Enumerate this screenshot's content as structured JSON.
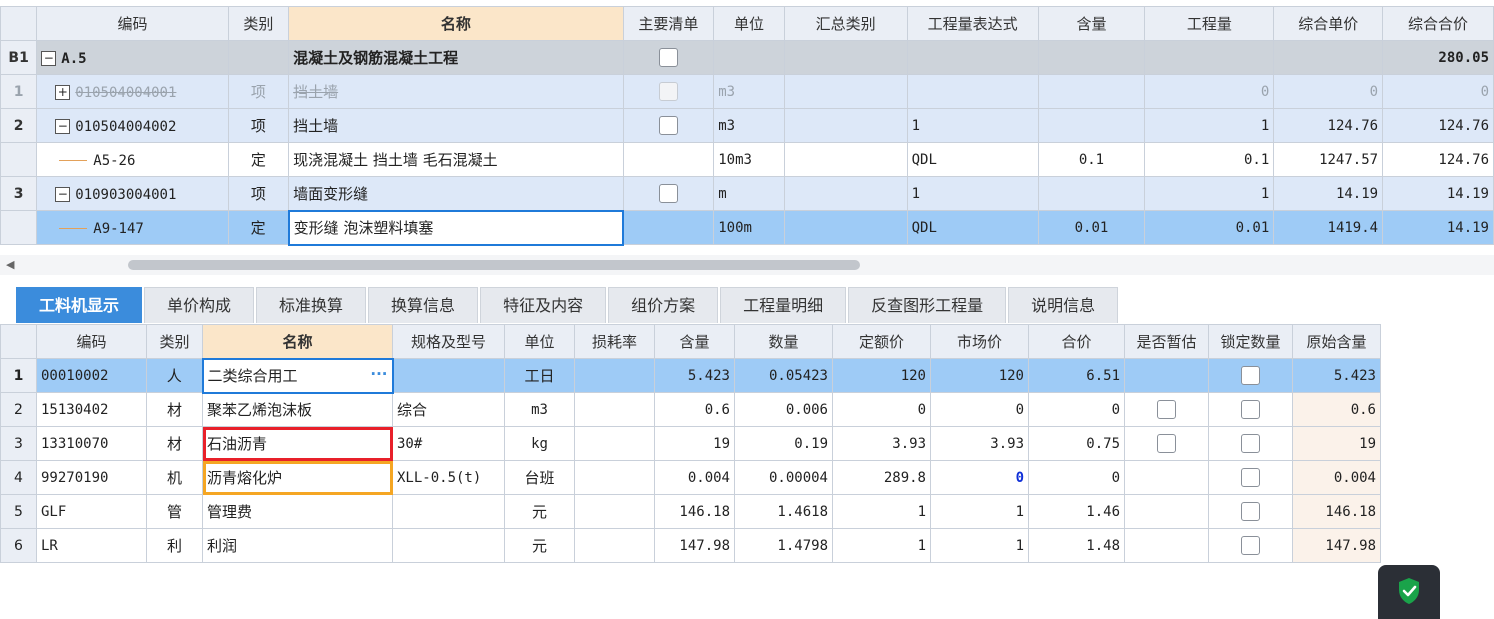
{
  "top_table": {
    "headers": [
      "",
      "编码",
      "类别",
      "名称",
      "主要清单",
      "单位",
      "汇总类别",
      "工程量表达式",
      "含量",
      "工程量",
      "综合单价",
      "综合合价"
    ],
    "rows": [
      {
        "rn": "B1",
        "code": "A.5",
        "type": "",
        "name": "混凝土及钢筋混凝土工程",
        "unit": "",
        "summary": "",
        "expr": "",
        "content": "",
        "qty": "",
        "unit_price": "",
        "total": "280.05"
      },
      {
        "rn": "1",
        "code": "010504004001",
        "type": "项",
        "name": "挡土墙",
        "unit": "m3",
        "summary": "",
        "expr": "",
        "content": "",
        "qty": "0",
        "unit_price": "0",
        "total": "0"
      },
      {
        "rn": "2",
        "code": "010504004002",
        "type": "项",
        "name": "挡土墙",
        "unit": "m3",
        "summary": "",
        "expr": "1",
        "content": "",
        "qty": "1",
        "unit_price": "124.76",
        "total": "124.76"
      },
      {
        "rn": "",
        "code": "A5-26",
        "type": "定",
        "name": "现浇混凝土 挡土墙 毛石混凝土",
        "unit": "10m3",
        "summary": "",
        "expr": "QDL",
        "content": "0.1",
        "qty": "0.1",
        "unit_price": "1247.57",
        "total": "124.76"
      },
      {
        "rn": "3",
        "code": "010903004001",
        "type": "项",
        "name": "墙面变形缝",
        "unit": "m",
        "summary": "",
        "expr": "1",
        "content": "",
        "qty": "1",
        "unit_price": "14.19",
        "total": "14.19"
      },
      {
        "rn": "",
        "code": "A9-147",
        "type": "定",
        "name": "变形缝 泡沫塑料填塞",
        "unit": "100m",
        "summary": "",
        "expr": "QDL",
        "content": "0.01",
        "qty": "0.01",
        "unit_price": "1419.4",
        "total": "14.19"
      }
    ]
  },
  "tabs": [
    "工料机显示",
    "单价构成",
    "标准换算",
    "换算信息",
    "特征及内容",
    "组价方案",
    "工程量明细",
    "反查图形工程量",
    "说明信息"
  ],
  "bottom_table": {
    "headers": [
      "",
      "编码",
      "类别",
      "名称",
      "规格及型号",
      "单位",
      "损耗率",
      "含量",
      "数量",
      "定额价",
      "市场价",
      "合价",
      "是否暂估",
      "锁定数量",
      "原始含量"
    ],
    "rows": [
      {
        "rn": "1",
        "code": "00010002",
        "type": "人",
        "name": "二类综合用工",
        "spec": "",
        "unit": "工日",
        "loss": "",
        "content": "5.423",
        "qty": "0.05423",
        "quota": "120",
        "market": "120",
        "sum": "6.51",
        "orig": "5.423"
      },
      {
        "rn": "2",
        "code": "15130402",
        "type": "材",
        "name": "聚苯乙烯泡沫板",
        "spec": "综合",
        "unit": "m3",
        "loss": "",
        "content": "0.6",
        "qty": "0.006",
        "quota": "0",
        "market": "0",
        "sum": "0",
        "orig": "0.6"
      },
      {
        "rn": "3",
        "code": "13310070",
        "type": "材",
        "name": "石油沥青",
        "spec": "30#",
        "unit": "kg",
        "loss": "",
        "content": "19",
        "qty": "0.19",
        "quota": "3.93",
        "market": "3.93",
        "sum": "0.75",
        "orig": "19"
      },
      {
        "rn": "4",
        "code": "99270190",
        "type": "机",
        "name": "沥青熔化炉",
        "spec": "XLL-0.5(t)",
        "unit": "台班",
        "loss": "",
        "content": "0.004",
        "qty": "0.00004",
        "quota": "289.8",
        "market": "0",
        "sum": "0",
        "orig": "0.004"
      },
      {
        "rn": "5",
        "code": "GLF",
        "type": "管",
        "name": "管理费",
        "spec": "",
        "unit": "元",
        "loss": "",
        "content": "146.18",
        "qty": "1.4618",
        "quota": "1",
        "market": "1",
        "sum": "1.46",
        "orig": "146.18"
      },
      {
        "rn": "6",
        "code": "LR",
        "type": "利",
        "name": "利润",
        "spec": "",
        "unit": "元",
        "loss": "",
        "content": "147.98",
        "qty": "1.4798",
        "quota": "1",
        "market": "1",
        "sum": "1.48",
        "orig": "147.98"
      }
    ]
  },
  "icons": {
    "shield": "shield-check-icon",
    "accent": "#3b8cdc",
    "shield_color": "#1aa34a"
  }
}
